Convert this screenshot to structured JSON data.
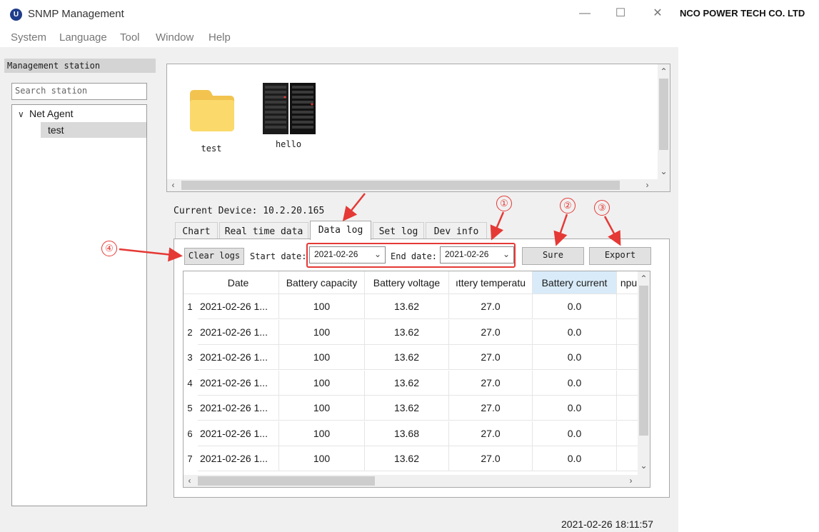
{
  "window": {
    "title": "SNMP Management",
    "logo_text": "U",
    "company": "NCO POWER TECH CO. LTD",
    "controls": [
      "—",
      "☐",
      "✕"
    ]
  },
  "menu": [
    "System",
    "Language",
    "Tool",
    "Window",
    "Help"
  ],
  "sidebar": {
    "header": "Management station",
    "search_placeholder": "Search station",
    "tree_root": "Net Agent",
    "tree_child": "test"
  },
  "devices": [
    {
      "label": "test",
      "icon": "folder-icon"
    },
    {
      "label": "hello",
      "icon": "ups-cabinet-icon"
    }
  ],
  "current_device": "Current Device: 10.2.20.165",
  "tabs": [
    "Chart",
    "Real time data",
    "Data log",
    "Set log",
    "Dev info"
  ],
  "active_tab": "Data log",
  "toolbar": {
    "clear_logs": "Clear logs",
    "start_label": "Start date:",
    "start_value": "2021-02-26",
    "end_label": "End date:",
    "end_value": "2021-02-26",
    "sure": "Sure",
    "export": "Export"
  },
  "table": {
    "headers": [
      "Date",
      "Battery capacity",
      "Battery voltage",
      "ıttery temperatu",
      "Battery current",
      "npu"
    ],
    "rows": [
      {
        "num": "1",
        "date": "2021-02-26 1...",
        "capacity": "100",
        "voltage": "13.62",
        "temperature": "27.0",
        "current": "0.0"
      },
      {
        "num": "2",
        "date": "2021-02-26 1...",
        "capacity": "100",
        "voltage": "13.62",
        "temperature": "27.0",
        "current": "0.0"
      },
      {
        "num": "3",
        "date": "2021-02-26 1...",
        "capacity": "100",
        "voltage": "13.62",
        "temperature": "27.0",
        "current": "0.0"
      },
      {
        "num": "4",
        "date": "2021-02-26 1...",
        "capacity": "100",
        "voltage": "13.62",
        "temperature": "27.0",
        "current": "0.0"
      },
      {
        "num": "5",
        "date": "2021-02-26 1...",
        "capacity": "100",
        "voltage": "13.62",
        "temperature": "27.0",
        "current": "0.0"
      },
      {
        "num": "6",
        "date": "2021-02-26 1...",
        "capacity": "100",
        "voltage": "13.68",
        "temperature": "27.0",
        "current": "0.0"
      },
      {
        "num": "7",
        "date": "2021-02-26 1...",
        "capacity": "100",
        "voltage": "13.62",
        "temperature": "27.0",
        "current": "0.0"
      }
    ]
  },
  "status_time": "2021-02-26 18:11:57",
  "callouts": [
    "①",
    "②",
    "③",
    "④"
  ],
  "colors": {
    "annotation": "#e53935",
    "highlight_header": "#d9ebf9",
    "logo": "#1f3d8a"
  }
}
